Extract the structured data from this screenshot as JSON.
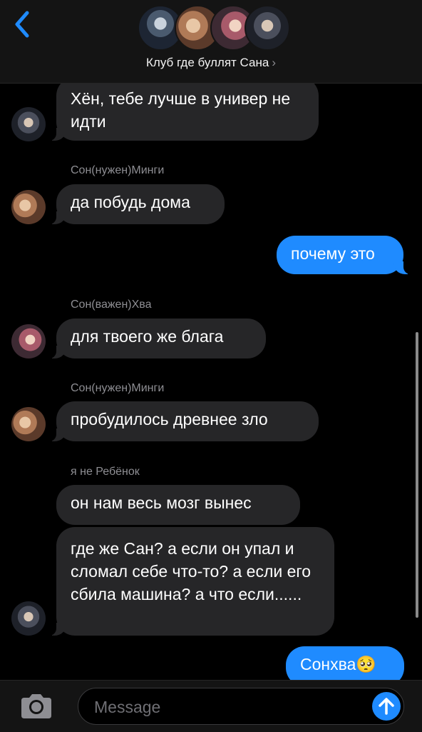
{
  "header": {
    "title": "Клуб где буллят Сана",
    "chevron": "›"
  },
  "composer": {
    "placeholder": "Message"
  },
  "messages": {
    "m1": {
      "text": "Хён, тебе лучше в универ не идти"
    },
    "s2": {
      "sender": "Сон(нужен)Минги"
    },
    "m2": {
      "text": "да побудь дома"
    },
    "m3": {
      "text": "почему это"
    },
    "s4": {
      "sender": "Сон(важен)Хва"
    },
    "m4": {
      "text": "для твоего же блага"
    },
    "s5": {
      "sender": "Сон(нужен)Минги"
    },
    "m5": {
      "text": "пробудилось древнее зло"
    },
    "s6": {
      "sender": "я не Ребёнок"
    },
    "m6": {
      "text": "он нам весь мозг вынес"
    },
    "m7": {
      "text": "где же Сан? а если он упал и сломал себе что-то? а если его сбила машина? а что если......"
    },
    "m8": {
      "text": "Сонхва🥺"
    }
  },
  "colors": {
    "outgoing_bubble": "#1f8bff",
    "incoming_bubble": "#262628",
    "accent": "#1f8bff"
  },
  "icons": {
    "back": "chevron-left-icon",
    "camera": "camera-icon",
    "send": "arrow-up-icon"
  }
}
